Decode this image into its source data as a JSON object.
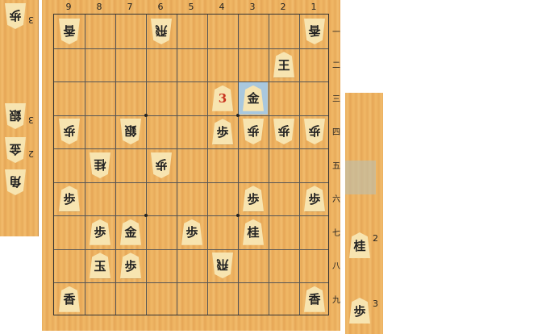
{
  "files": [
    "9",
    "8",
    "7",
    "6",
    "5",
    "4",
    "3",
    "2",
    "1"
  ],
  "ranks": [
    "一",
    "二",
    "三",
    "四",
    "五",
    "六",
    "七",
    "八",
    "九"
  ],
  "pieces": [
    {
      "file": 9,
      "rank": 1,
      "label": "香",
      "owner": "gote"
    },
    {
      "file": 6,
      "rank": 1,
      "label": "飛",
      "owner": "gote"
    },
    {
      "file": 1,
      "rank": 1,
      "label": "香",
      "owner": "gote"
    },
    {
      "file": 2,
      "rank": 2,
      "label": "王",
      "owner": "sente"
    },
    {
      "file": 4,
      "rank": 3,
      "label": "3",
      "owner": "sente",
      "red": true
    },
    {
      "file": 3,
      "rank": 3,
      "label": "金",
      "owner": "sente"
    },
    {
      "file": 9,
      "rank": 4,
      "label": "歩",
      "owner": "gote"
    },
    {
      "file": 7,
      "rank": 4,
      "label": "銀",
      "owner": "gote"
    },
    {
      "file": 4,
      "rank": 4,
      "label": "歩",
      "owner": "sente"
    },
    {
      "file": 3,
      "rank": 4,
      "label": "歩",
      "owner": "gote"
    },
    {
      "file": 2,
      "rank": 4,
      "label": "歩",
      "owner": "gote"
    },
    {
      "file": 1,
      "rank": 4,
      "label": "歩",
      "owner": "gote"
    },
    {
      "file": 8,
      "rank": 5,
      "label": "桂",
      "owner": "gote"
    },
    {
      "file": 6,
      "rank": 5,
      "label": "歩",
      "owner": "gote"
    },
    {
      "file": 9,
      "rank": 6,
      "label": "歩",
      "owner": "sente"
    },
    {
      "file": 3,
      "rank": 6,
      "label": "歩",
      "owner": "sente"
    },
    {
      "file": 1,
      "rank": 6,
      "label": "歩",
      "owner": "sente"
    },
    {
      "file": 8,
      "rank": 7,
      "label": "歩",
      "owner": "sente"
    },
    {
      "file": 7,
      "rank": 7,
      "label": "金",
      "owner": "sente"
    },
    {
      "file": 5,
      "rank": 7,
      "label": "歩",
      "owner": "sente"
    },
    {
      "file": 3,
      "rank": 7,
      "label": "桂",
      "owner": "sente"
    },
    {
      "file": 8,
      "rank": 8,
      "label": "玉",
      "owner": "sente"
    },
    {
      "file": 7,
      "rank": 8,
      "label": "歩",
      "owner": "sente"
    },
    {
      "file": 4,
      "rank": 8,
      "label": "飛",
      "owner": "gote"
    },
    {
      "file": 9,
      "rank": 9,
      "label": "香",
      "owner": "sente"
    },
    {
      "file": 1,
      "rank": 9,
      "label": "香",
      "owner": "sente"
    }
  ],
  "highlight": {
    "file": 3,
    "rank": 3
  },
  "gote_hand": [
    {
      "label": "歩",
      "count": "3"
    },
    {
      "label": "銀",
      "count": "3"
    },
    {
      "label": "金",
      "count": "2"
    },
    {
      "label": "角",
      "count": ""
    }
  ],
  "sente_hand": [
    {
      "label": "桂",
      "count": "2"
    },
    {
      "label": "歩",
      "count": "3"
    }
  ]
}
